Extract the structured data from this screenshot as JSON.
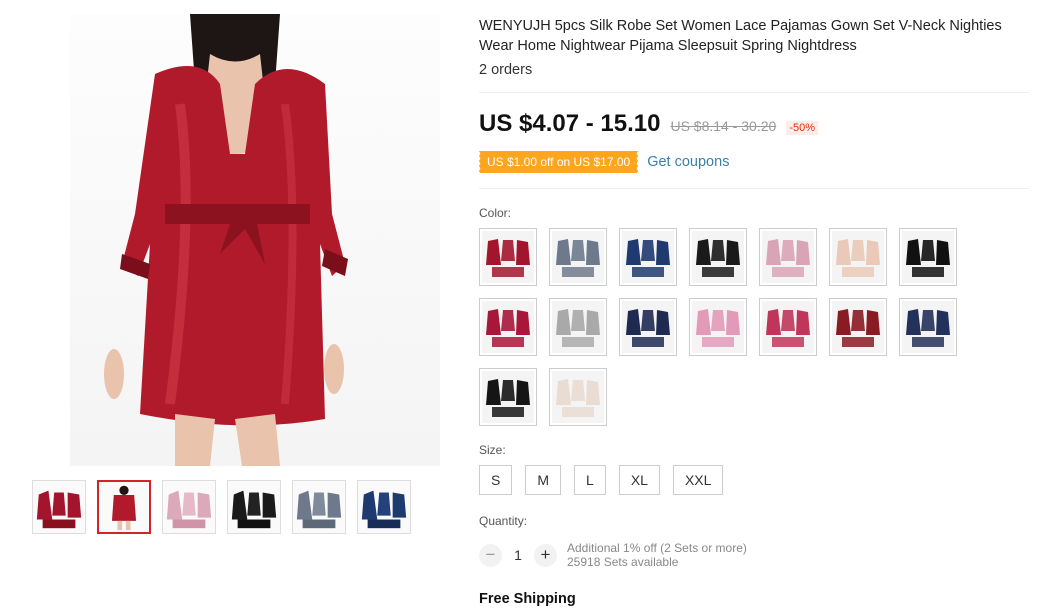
{
  "product": {
    "title": "WENYUJH 5pcs Silk Robe Set Women Lace Pajamas Gown Set V-Neck Nighties Wear Home Nightwear Pijama Sleepsuit Spring Nightdress",
    "orders": "2 orders",
    "price": "US $4.07 - 15.10",
    "old_price": "US $8.14 - 30.20",
    "discount": "-50%",
    "coupon": "US $1.00 off on US $17.00",
    "get_coupons": "Get coupons",
    "color_label": "Color:",
    "size_label": "Size:",
    "sizes": [
      "S",
      "M",
      "L",
      "XL",
      "XXL"
    ],
    "quantity_label": "Quantity:",
    "quantity": "1",
    "qty_minus": "−",
    "qty_plus": "+",
    "additional_discount": "Additional 1% off (2 Sets or more)",
    "available": "25918 Sets available",
    "shipping": "Free Shipping"
  },
  "colors": {
    "main_robe": "#b01a2a",
    "active_thumb_border": "#d4242b",
    "coupon_bg": "#fda51d",
    "discount_text": "#e62e04",
    "link": "#3a80a8",
    "swatches": [
      "#a3152c",
      "#6e7a8c",
      "#1f3a6e",
      "#1a1a1a",
      "#d9a4b6",
      "#eac9b8",
      "#111111",
      "#a8163a",
      "#a9a9a9",
      "#1e2a52",
      "#e39ab8",
      "#c0365a",
      "#8a1a24",
      "#23325a",
      "#151515",
      "#e9dcd2"
    ]
  }
}
